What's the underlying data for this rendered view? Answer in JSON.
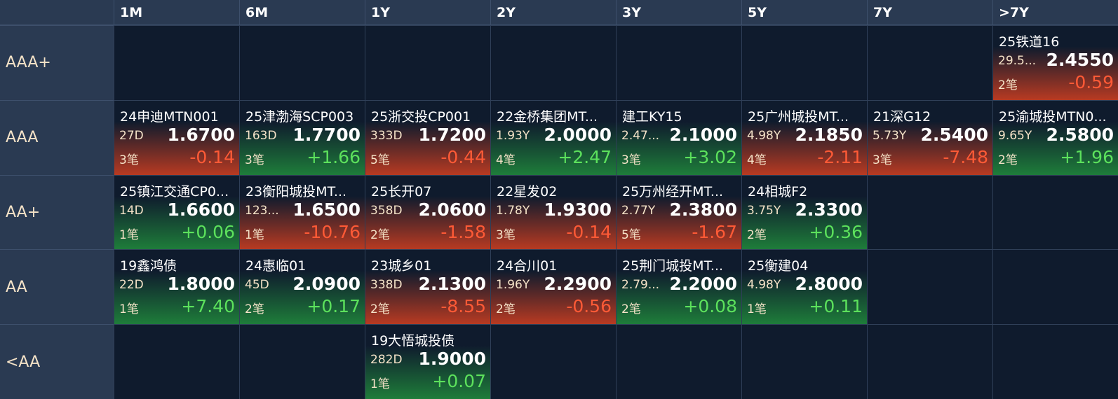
{
  "colors": {
    "background": "#0f1b2d",
    "header_bg": "#2a3a52",
    "up_gradient": "#1e7d3a",
    "down_gradient": "#b83a22",
    "positive_text": "#5ce15c",
    "negative_text": "#ff5a36"
  },
  "columns": [
    "1M",
    "6M",
    "1Y",
    "2Y",
    "3Y",
    "5Y",
    "7Y",
    ">7Y"
  ],
  "rows": [
    {
      "rating": "AAA+",
      "cells": [
        null,
        null,
        null,
        null,
        null,
        null,
        null,
        {
          "name": "25铁道16",
          "term": "29.5...",
          "rate": "2.4550",
          "count": "2笔",
          "change": "-0.59",
          "trend": "down"
        }
      ]
    },
    {
      "rating": "AAA",
      "cells": [
        {
          "name": "24申迪MTN001",
          "term": "27D",
          "rate": "1.6700",
          "count": "3笔",
          "change": "-0.14",
          "trend": "down"
        },
        {
          "name": "25津渤海SCP003",
          "term": "163D",
          "rate": "1.7700",
          "count": "3笔",
          "change": "+1.66",
          "trend": "up"
        },
        {
          "name": "25浙交投CP001",
          "term": "333D",
          "rate": "1.7200",
          "count": "5笔",
          "change": "-0.44",
          "trend": "down"
        },
        {
          "name": "22金桥集团MT...",
          "term": "1.93Y",
          "rate": "2.0000",
          "count": "4笔",
          "change": "+2.47",
          "trend": "up"
        },
        {
          "name": "建工KY15",
          "term": "2.47...",
          "rate": "2.1000",
          "count": "3笔",
          "change": "+3.02",
          "trend": "up"
        },
        {
          "name": "25广州城投MT...",
          "term": "4.98Y",
          "rate": "2.1850",
          "count": "4笔",
          "change": "-2.11",
          "trend": "down"
        },
        {
          "name": "21深G12",
          "term": "5.73Y",
          "rate": "2.5400",
          "count": "3笔",
          "change": "-7.48",
          "trend": "down"
        },
        {
          "name": "25渝城投MTN0...",
          "term": "9.65Y",
          "rate": "2.5800",
          "count": "2笔",
          "change": "+1.96",
          "trend": "up"
        }
      ]
    },
    {
      "rating": "AA+",
      "cells": [
        {
          "name": "25镇江交通CP0...",
          "term": "14D",
          "rate": "1.6600",
          "count": "1笔",
          "change": "+0.06",
          "trend": "up"
        },
        {
          "name": "23衡阳城投MT...",
          "term": "123...",
          "rate": "1.6500",
          "count": "1笔",
          "change": "-10.76",
          "trend": "down"
        },
        {
          "name": "25长开07",
          "term": "358D",
          "rate": "2.0600",
          "count": "2笔",
          "change": "-1.58",
          "trend": "down"
        },
        {
          "name": "22星发02",
          "term": "1.78Y",
          "rate": "1.9300",
          "count": "3笔",
          "change": "-0.14",
          "trend": "down"
        },
        {
          "name": "25万州经开MT...",
          "term": "2.77Y",
          "rate": "2.3800",
          "count": "5笔",
          "change": "-1.67",
          "trend": "down"
        },
        {
          "name": "24相城F2",
          "term": "3.75Y",
          "rate": "2.3300",
          "count": "2笔",
          "change": "+0.36",
          "trend": "up"
        },
        null,
        null
      ]
    },
    {
      "rating": "AA",
      "cells": [
        {
          "name": "19鑫鸿债",
          "term": "22D",
          "rate": "1.8000",
          "count": "1笔",
          "change": "+7.40",
          "trend": "up"
        },
        {
          "name": "24惠临01",
          "term": "45D",
          "rate": "2.0900",
          "count": "2笔",
          "change": "+0.17",
          "trend": "up"
        },
        {
          "name": "23城乡01",
          "term": "338D",
          "rate": "2.1300",
          "count": "2笔",
          "change": "-8.55",
          "trend": "down"
        },
        {
          "name": "24合川01",
          "term": "1.96Y",
          "rate": "2.2900",
          "count": "2笔",
          "change": "-0.56",
          "trend": "down"
        },
        {
          "name": "25荆门城投MT...",
          "term": "2.79...",
          "rate": "2.2000",
          "count": "2笔",
          "change": "+0.08",
          "trend": "up"
        },
        {
          "name": "25衡建04",
          "term": "4.98Y",
          "rate": "2.8000",
          "count": "1笔",
          "change": "+0.11",
          "trend": "up"
        },
        null,
        null
      ]
    },
    {
      "rating": "<AA",
      "cells": [
        null,
        null,
        {
          "name": "19大悟城投债",
          "term": "282D",
          "rate": "1.9000",
          "count": "1笔",
          "change": "+0.07",
          "trend": "up"
        },
        null,
        null,
        null,
        null,
        null
      ]
    }
  ]
}
